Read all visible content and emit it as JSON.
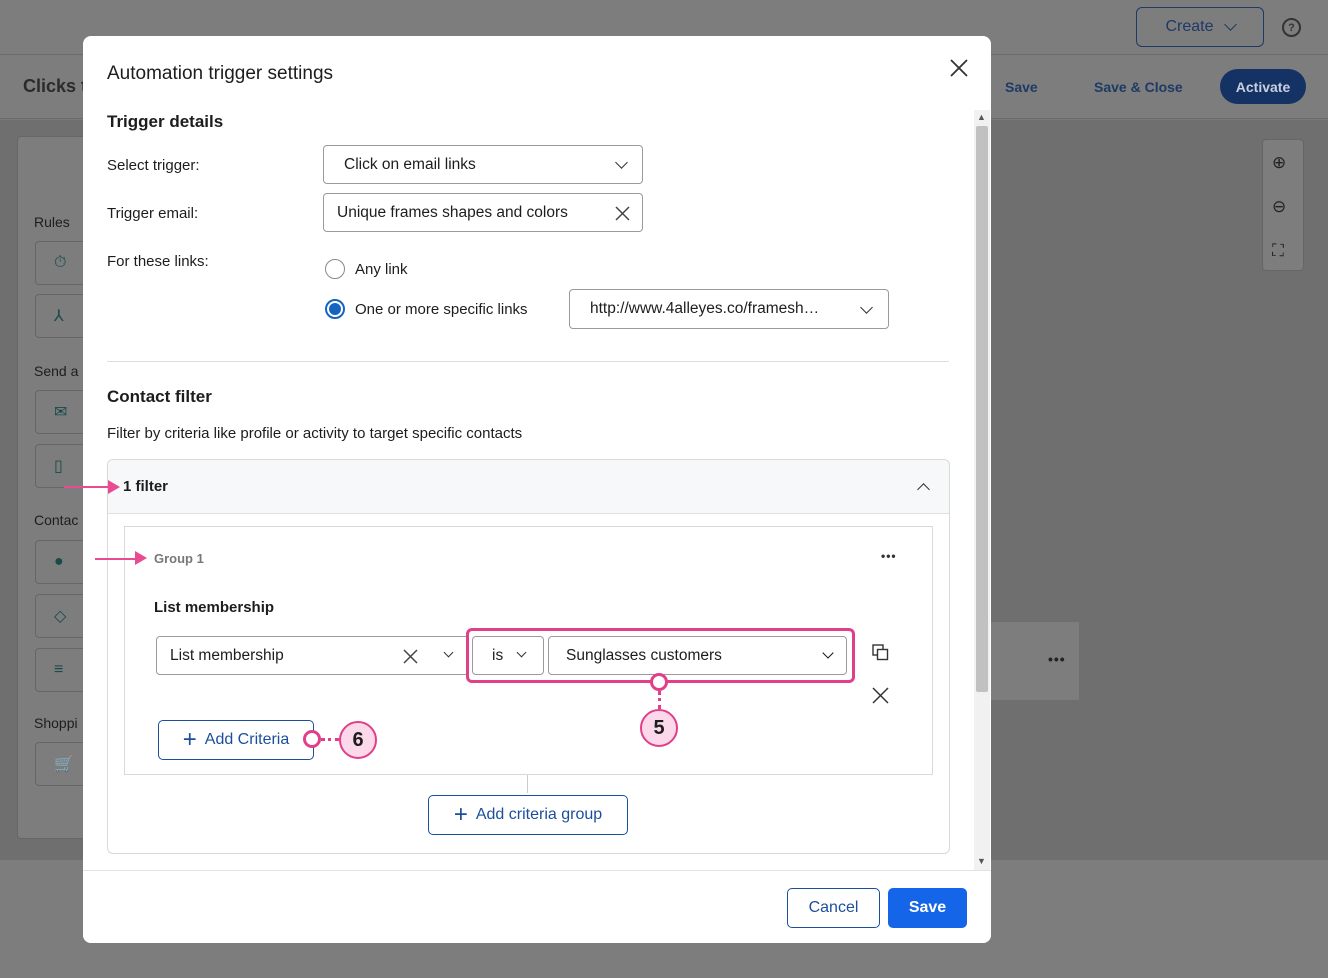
{
  "background": {
    "create_label": "Create",
    "help_label": "?",
    "page_title": "Clicks t",
    "save_label": "Save",
    "save_close_label": "Save & Close",
    "activate_label": "Activate",
    "sidebar": {
      "rules_label": "Rules",
      "send_label": "Send a",
      "contact_label": "Contac",
      "shopping_label": "Shoppi"
    },
    "card_menu": "•••"
  },
  "modal": {
    "title": "Automation trigger settings",
    "close_icon": "close-icon",
    "trigger_details": {
      "heading": "Trigger details",
      "select_trigger_label": "Select trigger:",
      "select_trigger_value": "Click on email links",
      "trigger_email_label": "Trigger email:",
      "trigger_email_value": "Unique frames shapes and colors",
      "links_label": "For these links:",
      "radio_any": "Any link",
      "radio_specific": "One or more specific links",
      "selected_radio": "One or more specific links",
      "link_value": "http://www.4alleyes.co/framesh…"
    },
    "contact_filter": {
      "heading": "Contact filter",
      "description": "Filter by criteria like profile or activity to target specific contacts",
      "filter_count": "1 filter",
      "group": {
        "name": "Group 1",
        "menu": "•••",
        "criteria_heading": "List membership",
        "field_value": "List membership",
        "operator_value": "is",
        "list_value": "Sunglasses customers",
        "add_criteria_label": "Add Criteria"
      },
      "add_group_label": "Add criteria group"
    },
    "footer": {
      "cancel_label": "Cancel",
      "save_label": "Save"
    }
  },
  "callouts": {
    "five": "5",
    "six": "6"
  },
  "colors": {
    "primary": "#1565e8",
    "link_blue": "#1b4f9a",
    "callout_pink": "#e0408a",
    "callout_fill": "#fbd9ea"
  }
}
